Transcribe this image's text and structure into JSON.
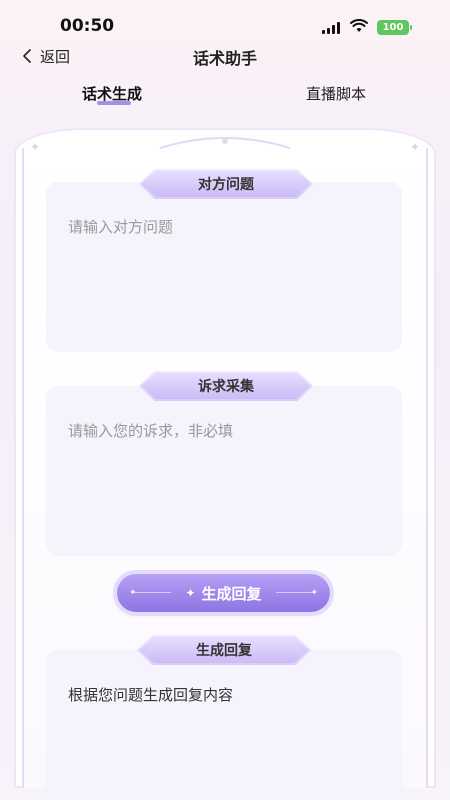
{
  "status_bar": {
    "time": "00:50",
    "battery": "100"
  },
  "nav": {
    "back_label": "返回",
    "title": "话术助手"
  },
  "tabs": [
    {
      "label": "话术生成",
      "active": true
    },
    {
      "label": "直播脚本",
      "active": false
    }
  ],
  "sections": {
    "question": {
      "label": "对方问题",
      "placeholder": "请输入对方问题"
    },
    "appeal": {
      "label": "诉求采集",
      "placeholder": "请输入您的诉求，非必填"
    },
    "reply": {
      "label": "生成回复",
      "text": "根据您问题生成回复内容"
    }
  },
  "generate_button": {
    "label": "生成回复",
    "icon": "sparkle-icon"
  },
  "colors": {
    "accent": "#8d74e3",
    "tab_underline": "#a68fe6",
    "battery": "#5ec85e"
  }
}
